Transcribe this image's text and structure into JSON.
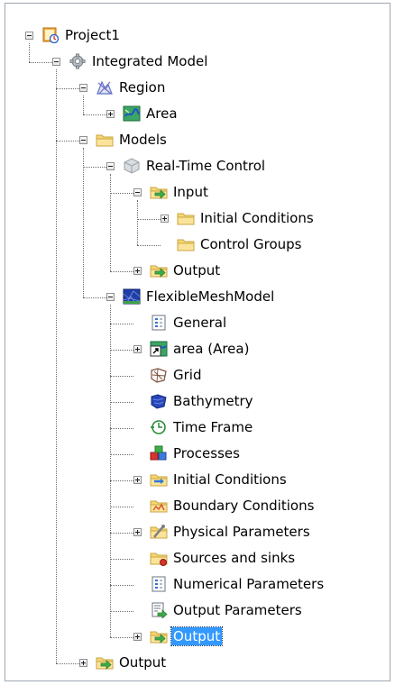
{
  "tree": {
    "nodes": [
      {
        "id": "project1",
        "label": "Project1",
        "icon": "project-icon",
        "expander": "minus"
      },
      {
        "id": "integrated-model",
        "label": "Integrated Model",
        "icon": "gear-icon",
        "expander": "minus"
      },
      {
        "id": "region",
        "label": "Region",
        "icon": "region-icon",
        "expander": "minus"
      },
      {
        "id": "area",
        "label": "Area",
        "icon": "area-map-icon",
        "expander": "plus"
      },
      {
        "id": "models",
        "label": "Models",
        "icon": "folder-icon",
        "expander": "minus"
      },
      {
        "id": "real-time-control",
        "label": "Real-Time Control",
        "icon": "rtc-cube-icon",
        "expander": "minus"
      },
      {
        "id": "rtc-input",
        "label": "Input",
        "icon": "input-folder-icon",
        "expander": "minus"
      },
      {
        "id": "rtc-initial-conditions",
        "label": "Initial Conditions",
        "icon": "folder-icon",
        "expander": "plus"
      },
      {
        "id": "rtc-control-groups",
        "label": "Control Groups",
        "icon": "folder-icon",
        "expander": null
      },
      {
        "id": "rtc-output",
        "label": "Output",
        "icon": "output-folder-icon",
        "expander": "plus"
      },
      {
        "id": "flexible-mesh-model",
        "label": "FlexibleMeshModel",
        "icon": "mesh-model-icon",
        "expander": "minus"
      },
      {
        "id": "fm-general",
        "label": "General",
        "icon": "properties-icon",
        "expander": null
      },
      {
        "id": "fm-area",
        "label": "area (Area)",
        "icon": "area-link-icon",
        "expander": "plus"
      },
      {
        "id": "fm-grid",
        "label": "Grid",
        "icon": "grid-icon",
        "expander": null
      },
      {
        "id": "fm-bathymetry",
        "label": "Bathymetry",
        "icon": "bathymetry-icon",
        "expander": null
      },
      {
        "id": "fm-time-frame",
        "label": "Time Frame",
        "icon": "clock-icon",
        "expander": null
      },
      {
        "id": "fm-processes",
        "label": "Processes",
        "icon": "processes-icon",
        "expander": null
      },
      {
        "id": "fm-initial-conditions",
        "label": "Initial Conditions",
        "icon": "initial-conditions-icon",
        "expander": "plus"
      },
      {
        "id": "fm-boundary-conditions",
        "label": "Boundary Conditions",
        "icon": "boundary-conditions-icon",
        "expander": null
      },
      {
        "id": "fm-physical-parameters",
        "label": "Physical Parameters",
        "icon": "physical-parameters-icon",
        "expander": "plus"
      },
      {
        "id": "fm-sources-and-sinks",
        "label": "Sources and sinks",
        "icon": "sources-sinks-icon",
        "expander": null
      },
      {
        "id": "fm-numerical-parameters",
        "label": "Numerical Parameters",
        "icon": "properties-icon",
        "expander": null
      },
      {
        "id": "fm-output-parameters",
        "label": "Output Parameters",
        "icon": "output-parameters-icon",
        "expander": null
      },
      {
        "id": "fm-output",
        "label": "Output",
        "icon": "output-folder-icon",
        "expander": "plus",
        "selected": true
      },
      {
        "id": "im-output",
        "label": "Output",
        "icon": "output-folder-icon",
        "expander": "plus"
      }
    ]
  },
  "colors": {
    "selection": "#3399ff",
    "folder": "#f7d774",
    "green_arrow": "#4caf50"
  }
}
